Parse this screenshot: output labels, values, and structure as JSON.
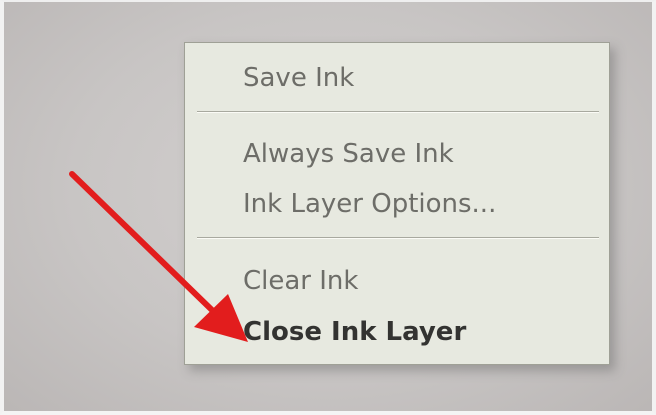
{
  "context_menu": {
    "items": [
      {
        "label": "Save Ink"
      },
      {
        "label": "Always Save Ink"
      },
      {
        "label": "Ink Layer Options..."
      },
      {
        "label": "Clear Ink"
      },
      {
        "label": "Close Ink Layer"
      }
    ]
  },
  "annotation": {
    "icon": "arrow-icon",
    "color": "#e21d1d"
  },
  "colors": {
    "menu_background": "#e7e9e0",
    "menu_text": "#6d6d68",
    "highlight_text": "#333331"
  }
}
